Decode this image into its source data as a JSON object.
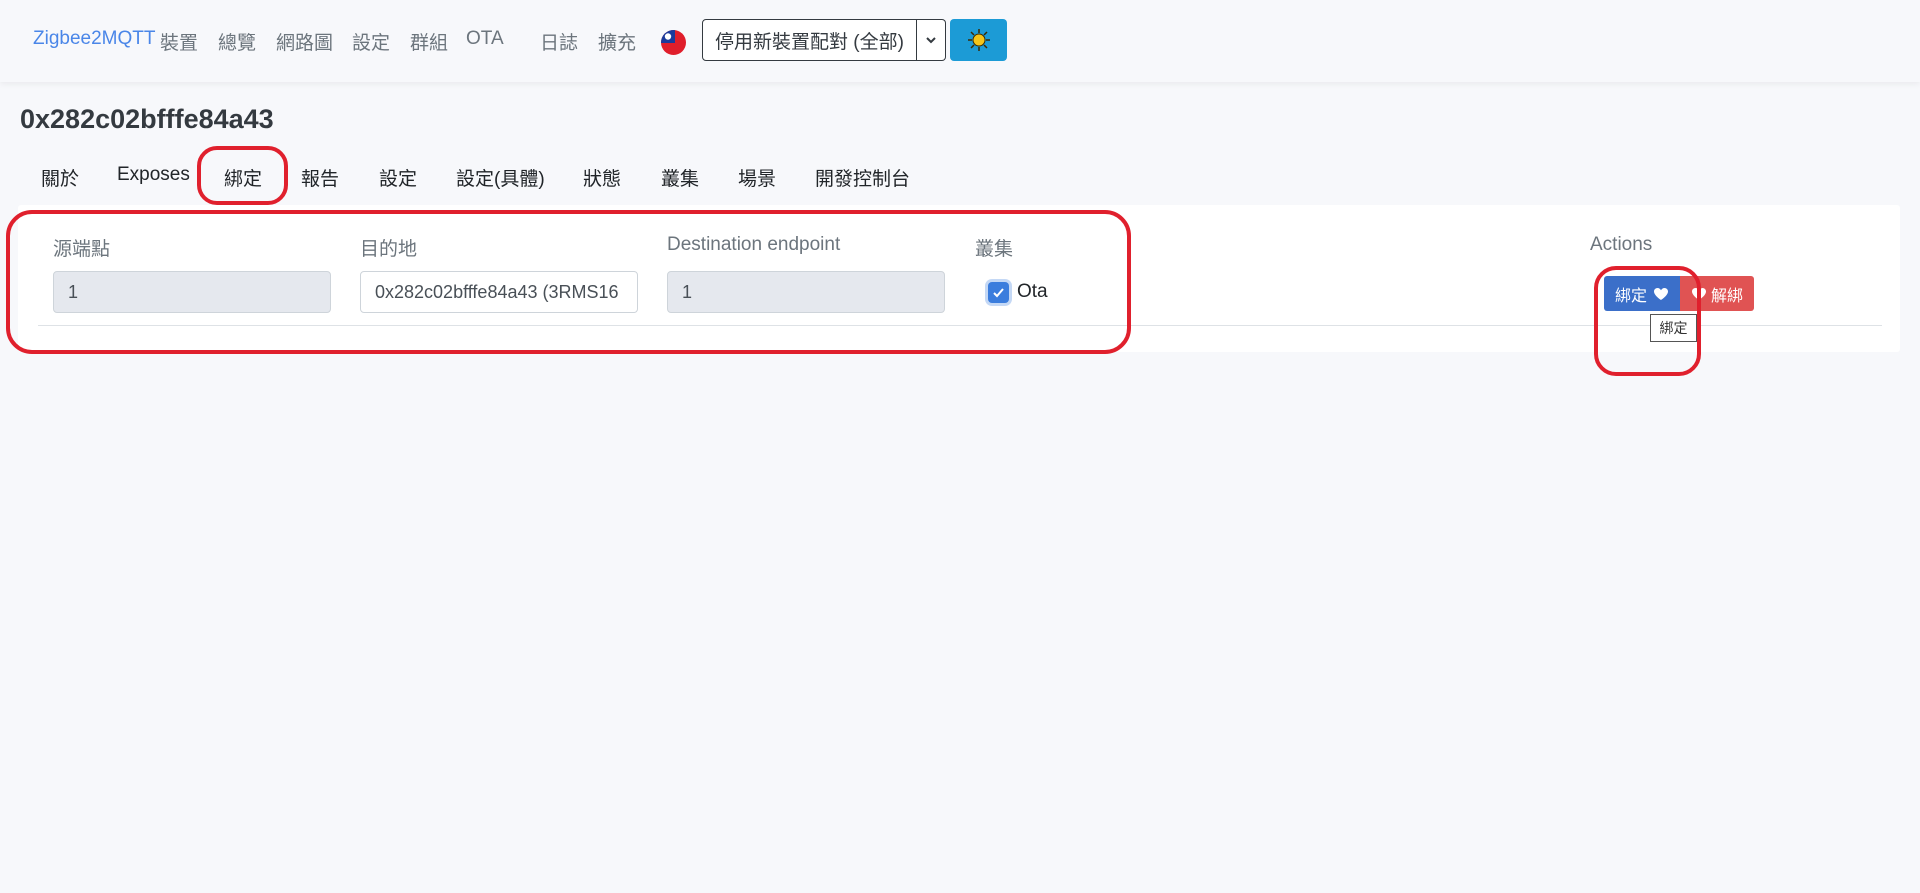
{
  "navbar": {
    "brand": "Zigbee2MQTT",
    "links": [
      "裝置",
      "總覽",
      "網路圖",
      "設定",
      "群組",
      "OTA",
      "日誌",
      "擴充"
    ],
    "permit_join_label": "停用新裝置配對 (全部)",
    "flag_icon": "taiwan-flag-icon",
    "theme_icon": "sun-icon"
  },
  "device": {
    "title": "0x282c02bfffe84a43"
  },
  "tabs": [
    "關於",
    "Exposes",
    "綁定",
    "報告",
    "設定",
    "設定(具體)",
    "狀態",
    "叢集",
    "場景",
    "開發控制台"
  ],
  "binding": {
    "headers": {
      "source": "源端點",
      "destination": "目的地",
      "destination_endpoint": "Destination endpoint",
      "clusters": "叢集",
      "actions": "Actions"
    },
    "row": {
      "source_endpoint": "1",
      "destination": "0x282c02bfffe84a43 (3RMS16",
      "destination_endpoint": "1",
      "cluster": "Ota",
      "cluster_checked": true,
      "bind_label": "綁定",
      "unbind_label": "解綁",
      "tooltip": "綁定"
    }
  },
  "colors": {
    "brand": "#4a86e8",
    "bind_button": "#3b6fc9",
    "unbind_button": "#e05353",
    "theme_button": "#1c9bd6",
    "annotation": "#e0202d"
  }
}
